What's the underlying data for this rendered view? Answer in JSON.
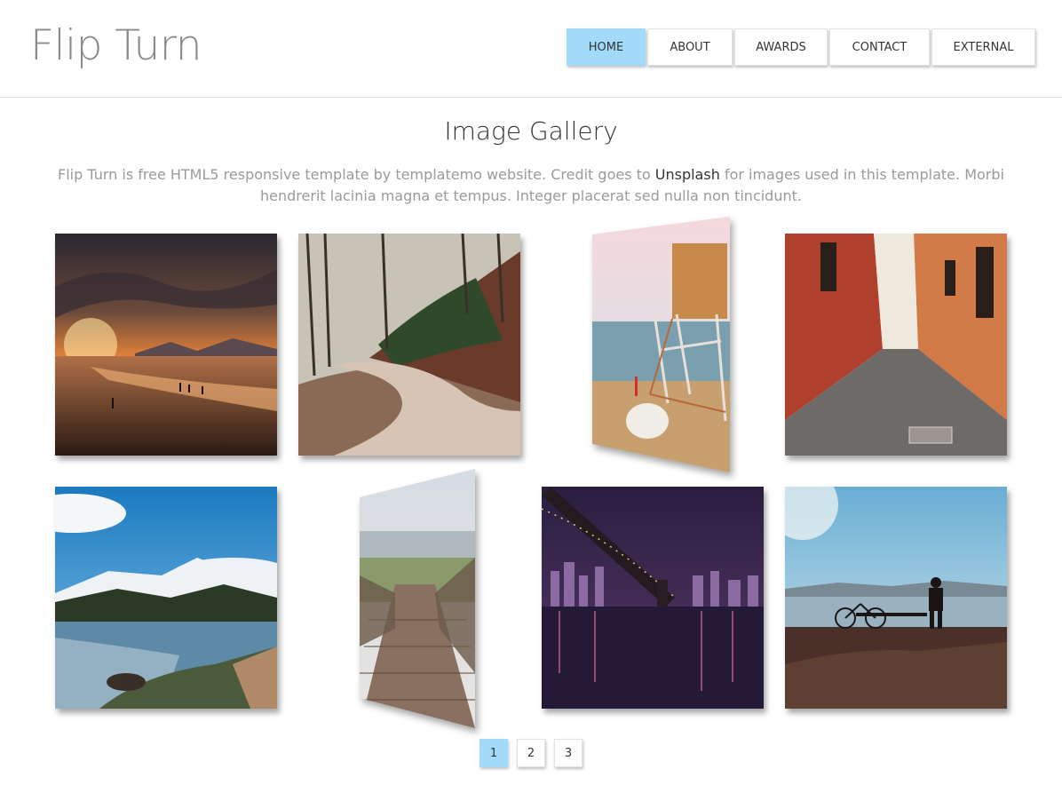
{
  "site": {
    "title": "Flip Turn"
  },
  "nav": {
    "items": [
      {
        "label": "HOME",
        "active": true
      },
      {
        "label": "ABOUT",
        "active": false
      },
      {
        "label": "AWARDS",
        "active": false
      },
      {
        "label": "CONTACT",
        "active": false
      },
      {
        "label": "EXTERNAL",
        "active": false
      }
    ]
  },
  "gallery": {
    "title": "Image Gallery",
    "description_pre": "Flip Turn is free HTML5 responsive template by templatemo website. Credit goes to ",
    "description_link": "Unsplash",
    "description_post": " for images used in this template. Morbi hendrerit lacinia magna et tempus. Integer placerat sed nulla non tincidunt.",
    "images": [
      "sunset-beach-photo",
      "forest-road-photo",
      "lifeguard-tower-photo",
      "alley-street-photo",
      "mountain-lake-photo",
      "boardwalk-photo",
      "bridge-night-photo",
      "man-bike-sea-photo"
    ]
  },
  "pagination": {
    "pages": [
      "1",
      "2",
      "3"
    ],
    "current": "1"
  },
  "colors": {
    "accent": "#a3daf9",
    "logo": "#8a8a8a",
    "text": "#333333",
    "muted": "#9a9a9a"
  }
}
